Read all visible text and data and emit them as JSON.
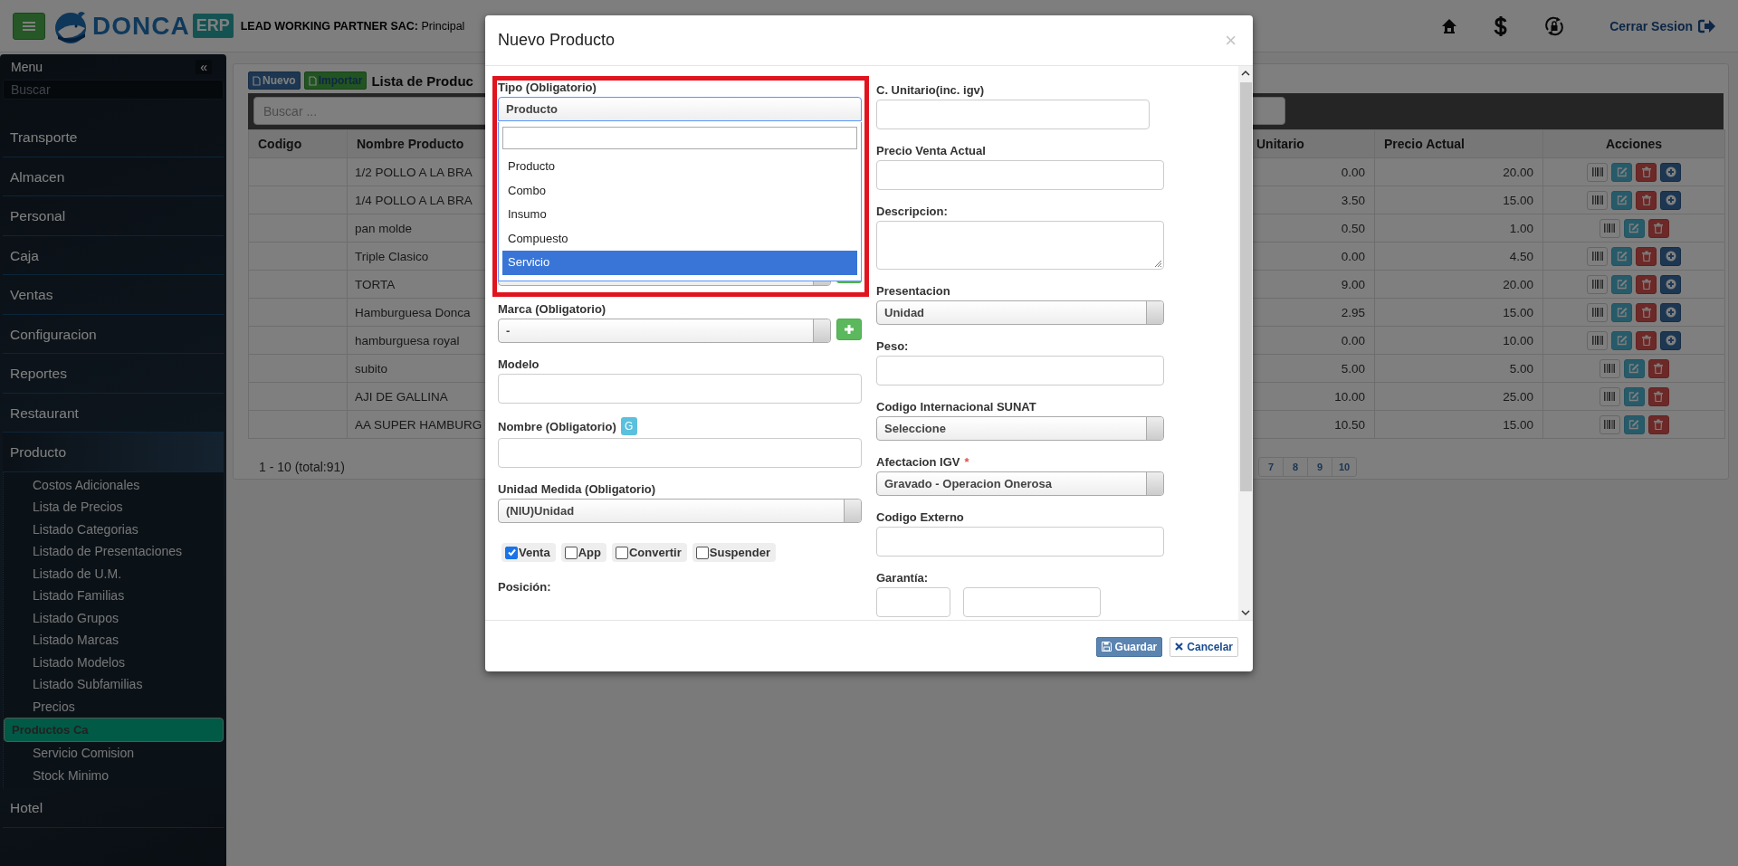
{
  "topbar": {
    "brand_name": "DONCA",
    "brand_badge": "ERP",
    "company": "**LEAD WORKING PARTNER SAC:** Principal",
    "logout": "Cerrar Sesion"
  },
  "sidebar": {
    "title": "Menu",
    "collapse": "«",
    "search": {
      "placeholder": "Buscar"
    },
    "items": [
      {
        "label": "Transporte",
        "expanded": false
      },
      {
        "label": "Almacen",
        "expanded": false
      },
      {
        "label": "Personal",
        "expanded": false
      },
      {
        "label": "Caja",
        "expanded": false
      },
      {
        "label": "Ventas",
        "expanded": false
      },
      {
        "label": "Configuracion",
        "expanded": false
      },
      {
        "label": "Reportes",
        "expanded": false
      },
      {
        "label": "Restaurant",
        "expanded": false
      },
      {
        "label": "Producto",
        "expanded": true,
        "children": [
          {
            "label": "Costos Adicionales",
            "selected": false
          },
          {
            "label": "Lista de Precios",
            "selected": false
          },
          {
            "label": "Listado Categorias",
            "selected": false
          },
          {
            "label": "Listado de Presentaciones",
            "selected": false
          },
          {
            "label": "Listado de U.M.",
            "selected": false
          },
          {
            "label": "Listado Familias",
            "selected": false
          },
          {
            "label": "Listado Grupos",
            "selected": false
          },
          {
            "label": "Listado Marcas",
            "selected": false
          },
          {
            "label": "Listado Modelos",
            "selected": false
          },
          {
            "label": "Listado Subfamilias",
            "selected": false
          },
          {
            "label": "Precios",
            "selected": false
          },
          {
            "label": "Productos Ca",
            "selected": true
          },
          {
            "label": "Servicio Comision",
            "selected": false
          },
          {
            "label": "Stock Minimo",
            "selected": false
          }
        ]
      },
      {
        "label": "Hotel",
        "expanded": false
      }
    ]
  },
  "products_panel": {
    "buttons": [
      {
        "label": "Nuevo",
        "kind": "primary"
      },
      {
        "label": "Importar",
        "kind": "success"
      }
    ],
    "title": "Lista de Produc",
    "search": {
      "placeholder": "Buscar ..."
    },
    "table": {
      "columns": [
        "Codigo",
        "Nombre Producto",
        "Unitario",
        "Precio Actual",
        "Acciones"
      ],
      "rows": [
        {
          "name": "1/2 POLLO A LA BRA",
          "unitario": "0.00",
          "precio": "20.00",
          "actions": [
            {
              "kind": "barcode"
            },
            {
              "kind": "edit"
            },
            {
              "kind": "delete"
            },
            {
              "kind": "add"
            }
          ]
        },
        {
          "name": "1/4 POLLO A LA BRA",
          "unitario": "3.50",
          "precio": "15.00",
          "actions": [
            {
              "kind": "barcode"
            },
            {
              "kind": "edit"
            },
            {
              "kind": "delete"
            },
            {
              "kind": "add"
            }
          ]
        },
        {
          "name": "pan molde",
          "unitario": "0.50",
          "precio": "1.00",
          "actions": [
            {
              "kind": "barcode"
            },
            {
              "kind": "edit"
            },
            {
              "kind": "delete"
            }
          ]
        },
        {
          "name": "Triple Clasico",
          "unitario": "0.00",
          "precio": "4.50",
          "actions": [
            {
              "kind": "barcode"
            },
            {
              "kind": "edit"
            },
            {
              "kind": "delete"
            },
            {
              "kind": "add"
            }
          ]
        },
        {
          "name": "TORTA",
          "unitario": "9.00",
          "precio": "20.00",
          "actions": [
            {
              "kind": "barcode"
            },
            {
              "kind": "edit"
            },
            {
              "kind": "delete"
            },
            {
              "kind": "add"
            }
          ]
        },
        {
          "name": "Hamburguesa Donca",
          "unitario": "2.95",
          "precio": "15.00",
          "actions": [
            {
              "kind": "barcode"
            },
            {
              "kind": "edit"
            },
            {
              "kind": "delete"
            },
            {
              "kind": "add"
            }
          ]
        },
        {
          "name": "hamburguesa royal",
          "unitario": "0.00",
          "precio": "10.00",
          "actions": [
            {
              "kind": "barcode"
            },
            {
              "kind": "edit"
            },
            {
              "kind": "delete"
            },
            {
              "kind": "add"
            }
          ]
        },
        {
          "name": "subito",
          "unitario": "5.00",
          "precio": "5.00",
          "actions": [
            {
              "kind": "barcode"
            },
            {
              "kind": "edit"
            },
            {
              "kind": "delete"
            }
          ]
        },
        {
          "name": "AJI DE GALLINA",
          "unitario": "10.00",
          "precio": "25.00",
          "actions": [
            {
              "kind": "barcode"
            },
            {
              "kind": "edit"
            },
            {
              "kind": "delete"
            }
          ]
        },
        {
          "name": "AA SUPER HAMBURG",
          "unitario": "10.50",
          "precio": "15.00",
          "actions": [
            {
              "kind": "barcode"
            },
            {
              "kind": "edit"
            },
            {
              "kind": "delete"
            }
          ]
        }
      ]
    },
    "pagination": {
      "summary": "1 - 10 (total:91)",
      "pages": [
        "7",
        "8",
        "9",
        "10"
      ]
    }
  },
  "modal": {
    "title": "Nuevo Producto",
    "close": "×",
    "tipo": {
      "label": "Tipo (Obligatorio)",
      "value": "Producto",
      "options": [
        {
          "label": "Producto",
          "highlighted": false
        },
        {
          "label": "Combo",
          "highlighted": false
        },
        {
          "label": "Insumo",
          "highlighted": false
        },
        {
          "label": "Compuesto",
          "highlighted": false
        },
        {
          "label": "Servicio",
          "highlighted": true
        }
      ]
    },
    "left_fields": [
      {
        "kind": "select_add"
      },
      {
        "kind": "select_add",
        "label": "Marca (Obligatorio)",
        "value": "-"
      },
      {
        "kind": "input",
        "label": "Modelo"
      },
      {
        "kind": "input",
        "label": "Nombre (Obligatorio)",
        "badge": "G"
      },
      {
        "kind": "select",
        "label": "Unidad Medida (Obligatorio)",
        "value": "(NIU)Unidad"
      }
    ],
    "checkboxes": [
      {
        "label": "Venta",
        "checked": true
      },
      {
        "label": "App",
        "checked": false
      },
      {
        "label": "Convertir",
        "checked": false
      },
      {
        "label": "Suspender",
        "checked": false
      }
    ],
    "position_label": "Posición:",
    "right_fields": [
      {
        "kind": "input",
        "label": "C. Unitario(inc. igv)"
      },
      {
        "kind": "input",
        "label": "Precio Venta Actual"
      },
      {
        "kind": "textarea",
        "label": "Descripcion:"
      },
      {
        "kind": "select",
        "label": "Presentacion",
        "value": "Unidad"
      },
      {
        "kind": "input",
        "label": "Peso:"
      },
      {
        "kind": "select",
        "label": "Codigo Internacional SUNAT",
        "value": "Seleccione"
      },
      {
        "kind": "select",
        "label": "Afectacion IGV",
        "required_mark": "*",
        "value": "Gravado - Operacion Onerosa"
      },
      {
        "kind": "input",
        "label": "Codigo Externo"
      },
      {
        "kind": "pair",
        "label": "Garantía:"
      }
    ],
    "buttons": [
      {
        "label": "Guardar",
        "kind": "save"
      },
      {
        "label": "Cancelar",
        "kind": "cancel"
      }
    ]
  }
}
